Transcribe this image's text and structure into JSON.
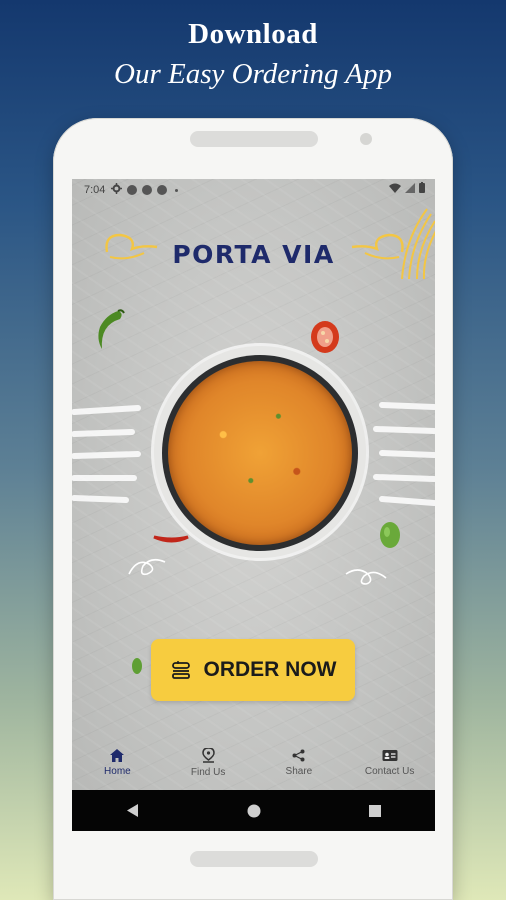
{
  "promo": {
    "line1": "Download",
    "line2": "Our Easy Ordering App"
  },
  "statusbar": {
    "time": "7:04",
    "icons": [
      "gear-icon",
      "dot-icon",
      "dot-icon",
      "dot-icon",
      "wifi-icon",
      "signal-icon",
      "battery-icon"
    ]
  },
  "app": {
    "brand": "PORTA VIA",
    "order_label": "ORDER NOW"
  },
  "bottom_nav": {
    "items": [
      {
        "label": "Home",
        "icon": "home-icon",
        "active": true
      },
      {
        "label": "Find Us",
        "icon": "location-pin-icon",
        "active": false
      },
      {
        "label": "Share",
        "icon": "share-icon",
        "active": false
      },
      {
        "label": "Contact Us",
        "icon": "contact-card-icon",
        "active": false
      }
    ]
  },
  "colors": {
    "accent": "#1e2a6b",
    "button": "#f7cc3f",
    "deco_yellow": "#f3c644"
  }
}
